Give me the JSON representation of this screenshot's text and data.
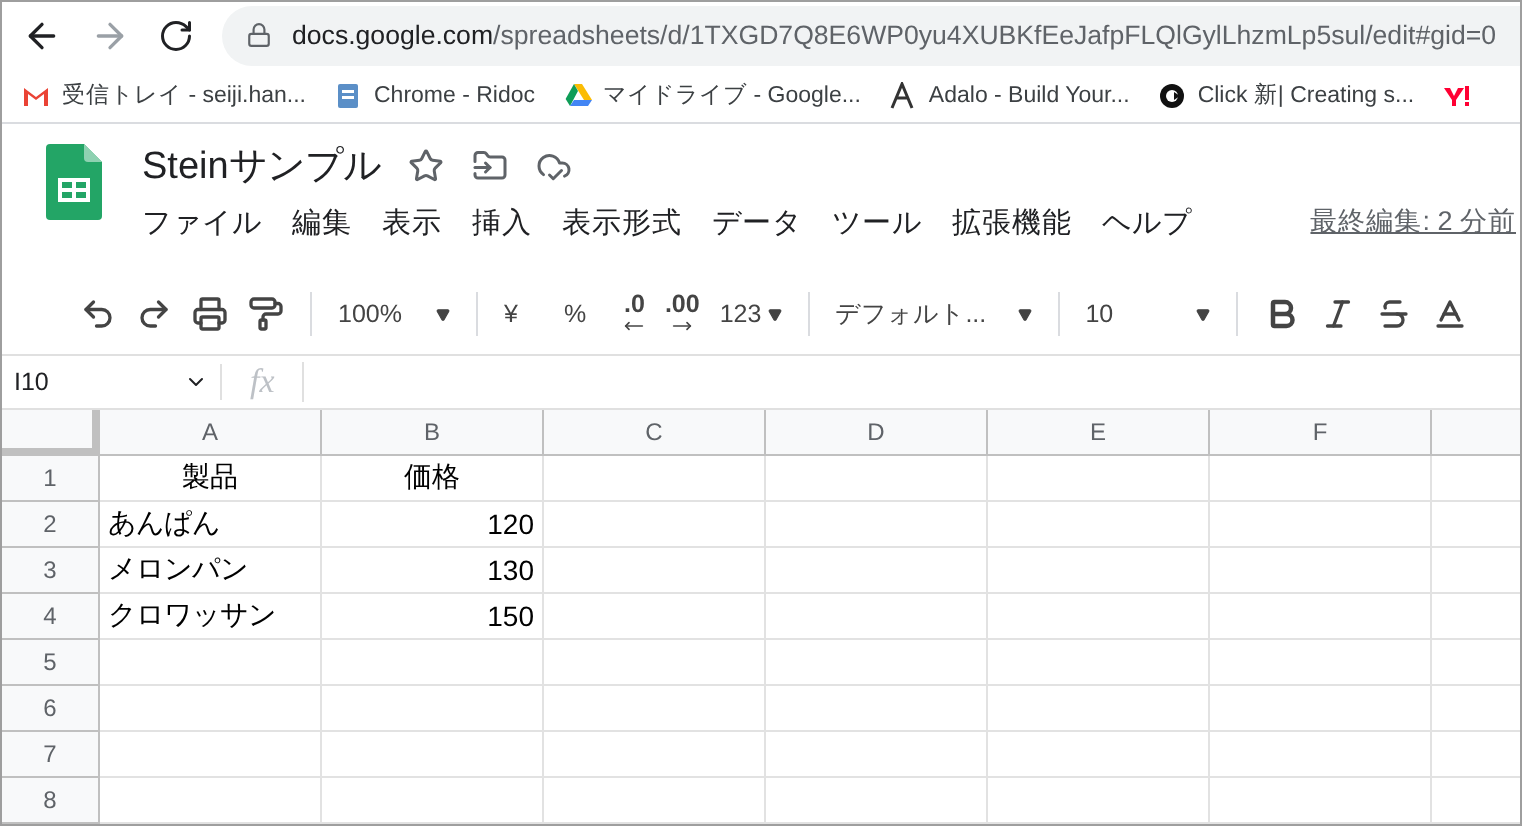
{
  "browser": {
    "url_host": "docs.google.com",
    "url_path": "/spreadsheets/d/1TXGD7Q8E6WP0yu4XUBKfEeJafpFLQlGylLhzmLp5sul/edit#gid=0"
  },
  "bookmarks": [
    {
      "kind": "mail",
      "label": "受信トレイ - seiji.han..."
    },
    {
      "kind": "doc",
      "label": "Chrome - Ridoc"
    },
    {
      "kind": "drive",
      "label": "マイドライブ - Google..."
    },
    {
      "kind": "adalo",
      "label": "Adalo - Build Your..."
    },
    {
      "kind": "click",
      "label": "Click 新| Creating s..."
    },
    {
      "kind": "yahoo"
    }
  ],
  "document": {
    "title": "Steinサンプル",
    "menu": [
      "ファイル",
      "編集",
      "表示",
      "挿入",
      "表示形式",
      "データ",
      "ツール",
      "拡張機能",
      "ヘルプ"
    ],
    "last_edit": "最終編集: 2 分前"
  },
  "toolbar": {
    "zoom": "100%",
    "currency": "¥",
    "percent": "%",
    "decrease_decimals": ".0",
    "increase_decimals": ".00",
    "number_format": "123",
    "font": "デフォルト...",
    "font_size": "10"
  },
  "formula_bar": {
    "cell_ref": "I10",
    "function_label": "fx"
  },
  "sheet": {
    "columns": [
      "A",
      "B",
      "C",
      "D",
      "E",
      "F"
    ],
    "rows": [
      {
        "number": "1",
        "cells": [
          {
            "text": "製品",
            "kind": "heading"
          },
          {
            "text": "価格",
            "kind": "heading"
          }
        ]
      },
      {
        "number": "2",
        "cells": [
          {
            "text": "あんぱん",
            "kind": "text"
          },
          {
            "text": "120",
            "kind": "number"
          }
        ]
      },
      {
        "number": "3",
        "cells": [
          {
            "text": "メロンパン",
            "kind": "text"
          },
          {
            "text": "130",
            "kind": "number"
          }
        ]
      },
      {
        "number": "4",
        "cells": [
          {
            "text": "クロワッサン",
            "kind": "text"
          },
          {
            "text": "150",
            "kind": "number"
          }
        ]
      },
      {
        "number": "5",
        "cells": []
      },
      {
        "number": "6",
        "cells": []
      },
      {
        "number": "7",
        "cells": []
      },
      {
        "number": "8",
        "cells": []
      }
    ]
  }
}
